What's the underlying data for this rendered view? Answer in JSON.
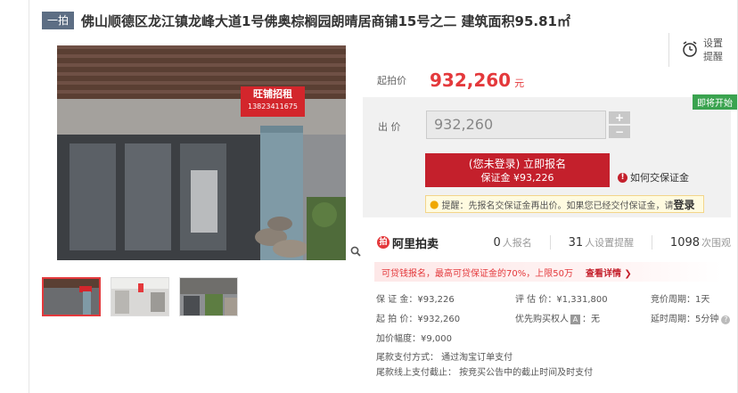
{
  "header": {
    "badge": "一拍",
    "title": "佛山顺德区龙江镇龙峰大道1号佛奥棕榈园朗晴居商铺15号之二 建筑面积95.81㎡"
  },
  "photo": {
    "sign_line1": "旺铺招租",
    "sign_line2": "13823411675"
  },
  "remind": {
    "line1": "设置",
    "line2": "提醒"
  },
  "price": {
    "label": "起拍价",
    "value": "932,260",
    "unit": "元"
  },
  "status_tag": "即将开始",
  "bid": {
    "label": "出  价",
    "value": "932,260",
    "plus": "+",
    "minus": "−"
  },
  "register": {
    "main": "(您未登录) 立即报名",
    "sub": "保证金 ¥93,226"
  },
  "how_pay": "如何交保证金",
  "tip": {
    "prefix": "提醒：先报名交保证金再出价。如果您已经交付保证金，请",
    "login": "登录"
  },
  "ali": {
    "logo": "阿里拍卖",
    "stats": [
      {
        "num": "0",
        "label": "人报名"
      },
      {
        "num": "31",
        "label": "人设置提醒"
      },
      {
        "num": "1098",
        "label": "次围观"
      }
    ]
  },
  "loan": {
    "text": "可贷钱报名，最高可贷保证金的70%，上限50万",
    "link": "查看详情 ❯"
  },
  "info": {
    "deposit": "保 证 金：¥93,226",
    "appraisal": "评 估 价：¥1,331,800",
    "cycle": "竞价周期：1天",
    "start": "起 拍 价：¥932,260",
    "priority_pre": "优先购买权人",
    "priority_tag": "🅐",
    "priority_post": "：无",
    "delay": "延时周期：5分钟",
    "increment": "加价幅度：¥9,000",
    "tail_pay": "尾款支付方式：  通过淘宝订单支付",
    "tail_deadline": "尾款线上支付截止：  按竞买公告中的截止时间及时支付"
  }
}
